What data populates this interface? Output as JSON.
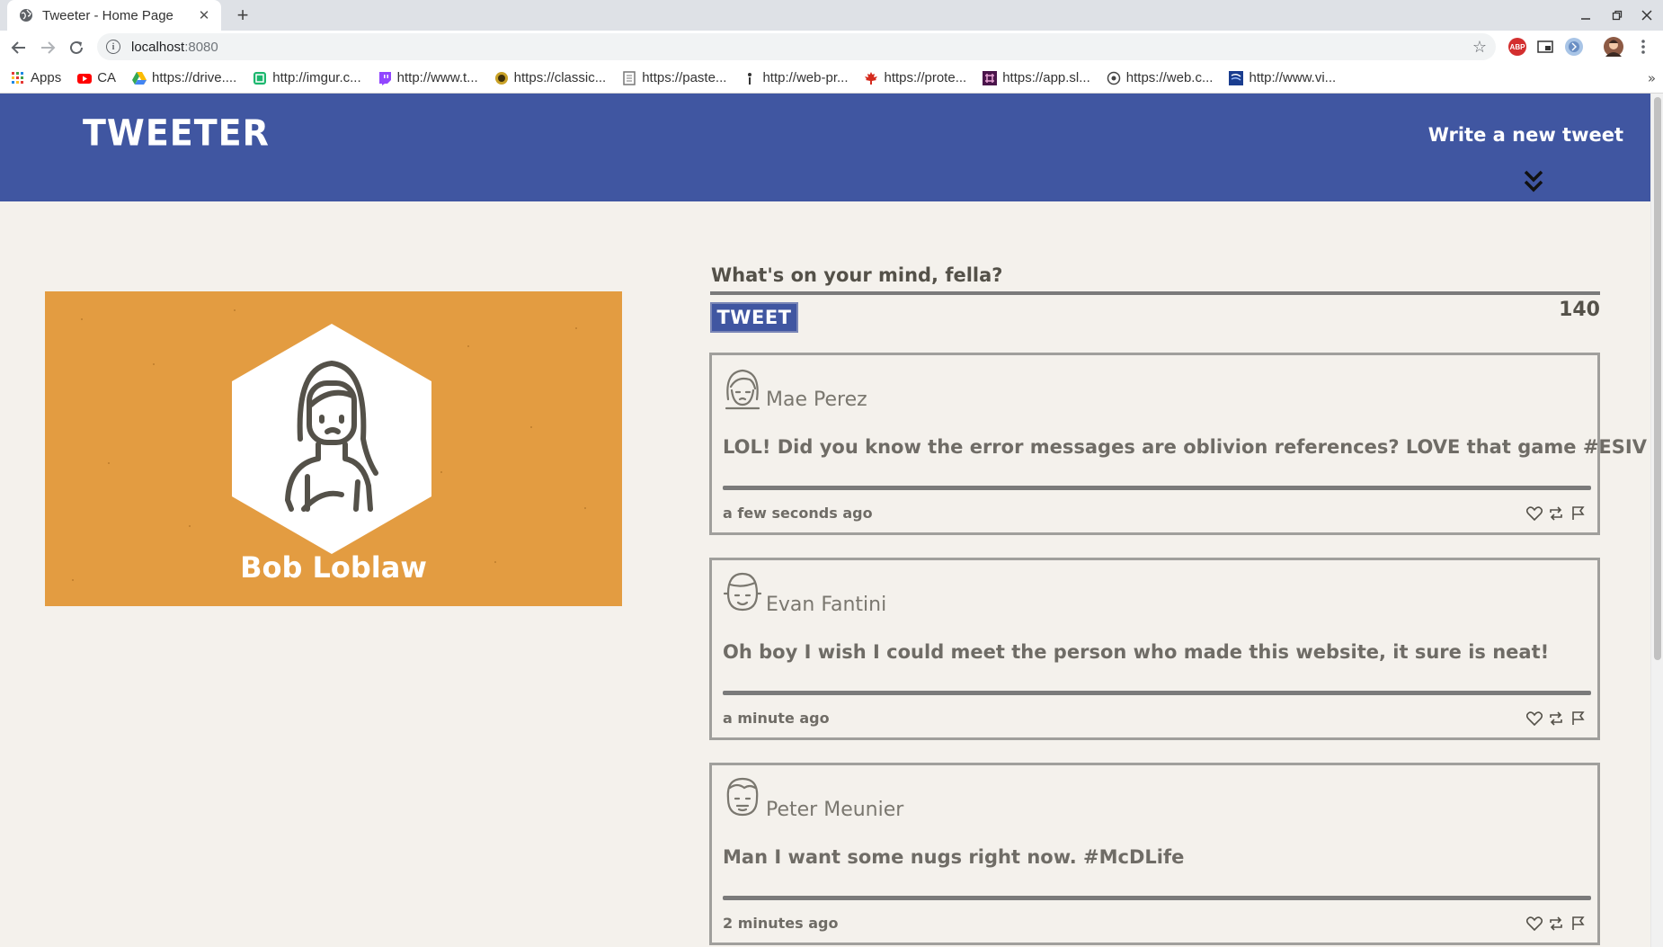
{
  "browser": {
    "tab_title": "Tweeter - Home Page",
    "new_tab_symbol": "+",
    "url_host": "localhost",
    "url_port": ":8080",
    "bookmarks": [
      {
        "label": "Apps",
        "icon": "apps-grid-icon",
        "color": "#e53935"
      },
      {
        "label": "CA",
        "icon": "youtube-icon",
        "color": "#ff0000"
      },
      {
        "label": "https://drive....",
        "icon": "google-drive-icon",
        "color": "#fbbc04"
      },
      {
        "label": "http://imgur.c...",
        "icon": "imgur-icon",
        "color": "#1bb76e"
      },
      {
        "label": "http://www.t...",
        "icon": "twitch-icon",
        "color": "#9146ff"
      },
      {
        "label": "https://classic...",
        "icon": "classic-site-icon",
        "color": "#8a6d1a"
      },
      {
        "label": "https://paste...",
        "icon": "pastebin-icon",
        "color": "#777777"
      },
      {
        "label": "http://web-pr...",
        "icon": "web-project-icon",
        "color": "#333333"
      },
      {
        "label": "https://prote...",
        "icon": "maple-leaf-icon",
        "color": "#d52b1e"
      },
      {
        "label": "https://app.sl...",
        "icon": "slack-icon",
        "color": "#4a154b"
      },
      {
        "label": "https://web.c...",
        "icon": "web-circle-icon",
        "color": "#444444"
      },
      {
        "label": "http://www.vi...",
        "icon": "vimeo-icon",
        "color": "#1a3d8f"
      }
    ],
    "bookmarks_overflow": "»"
  },
  "header": {
    "logo": "TWEETER",
    "compose_label": "Write a new tweet",
    "brand_color": "#4056a1"
  },
  "profile": {
    "name": "Bob Loblaw",
    "card_color": "#e39c41"
  },
  "composer": {
    "prompt": "What's on your mind, fella?",
    "tweet_button": "TWEET",
    "counter": "140"
  },
  "tweets": [
    {
      "author": "Mae Perez",
      "content": "LOL! Did you know the error messages are oblivion references? LOVE that game #ESIV",
      "time": "a few seconds ago"
    },
    {
      "author": "Evan Fantini",
      "content": "Oh boy I wish I could meet the person who made this website, it sure is neat!",
      "time": "a minute ago"
    },
    {
      "author": "Peter Meunier",
      "content": "Man I want some nugs right now. #McDLife",
      "time": "2 minutes ago"
    }
  ]
}
